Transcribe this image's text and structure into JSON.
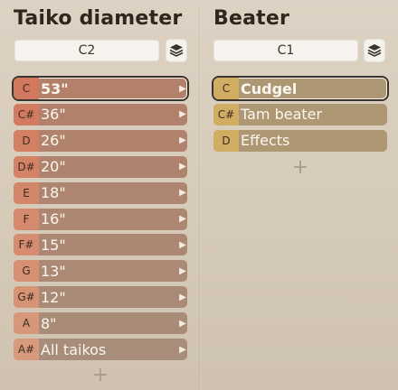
{
  "left": {
    "title": "Taiko diameter",
    "selector_value": "C2",
    "items": [
      {
        "note": "C",
        "label": "53\"",
        "selected": true
      },
      {
        "note": "C#",
        "label": "36\""
      },
      {
        "note": "D",
        "label": "26\""
      },
      {
        "note": "D#",
        "label": "20\""
      },
      {
        "note": "E",
        "label": "18\""
      },
      {
        "note": "F",
        "label": "16\""
      },
      {
        "note": "F#",
        "label": "15\""
      },
      {
        "note": "G",
        "label": "13\""
      },
      {
        "note": "G#",
        "label": "12\""
      },
      {
        "note": "A",
        "label": "8\""
      },
      {
        "note": "A#",
        "label": "All taikos"
      }
    ],
    "add_label": "+"
  },
  "right": {
    "title": "Beater",
    "selector_value": "C1",
    "items": [
      {
        "note": "C",
        "label": "Cudgel",
        "selected": true
      },
      {
        "note": "C#",
        "label": "Tam beater"
      },
      {
        "note": "D",
        "label": "Effects"
      }
    ],
    "add_label": "+"
  },
  "colors": {
    "left_note_gradient": [
      "#d2785e",
      "#d89a7c"
    ],
    "left_label_gradient": [
      "#b3806a",
      "#a78d7a"
    ],
    "right_note": "#d1ac63",
    "right_label": "#ad9873"
  },
  "icons": {
    "layers": "layers-icon",
    "chevron": "chevron-right-icon",
    "add": "plus-icon"
  }
}
